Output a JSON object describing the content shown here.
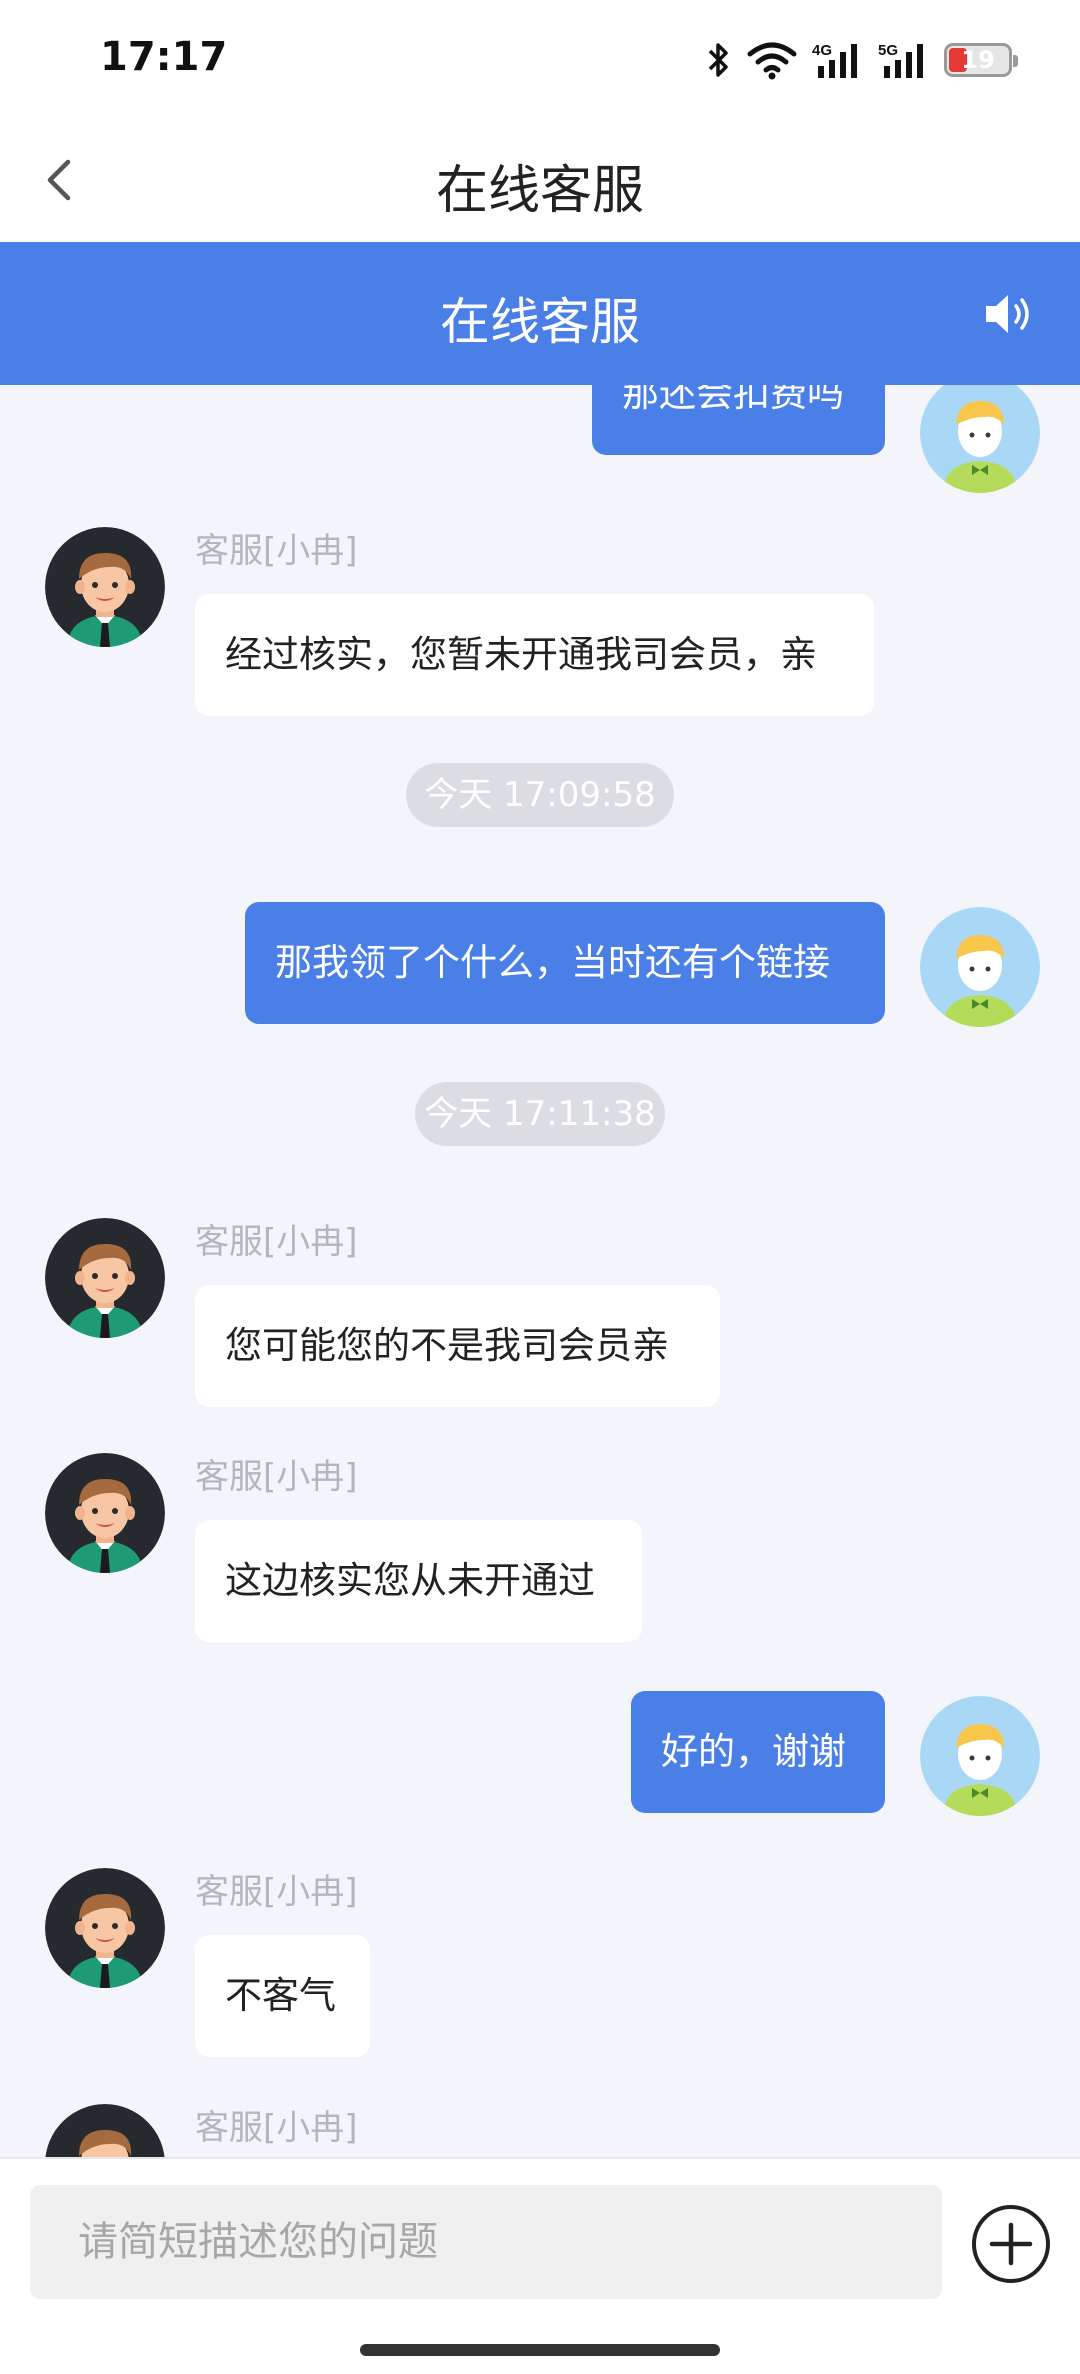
{
  "status_bar": {
    "time": "17:17",
    "network_1": "4G",
    "network_2": "5G",
    "battery_level": "19",
    "icons": [
      "bluetooth-icon",
      "wifi-icon",
      "signal-4g-icon",
      "signal-5g-icon",
      "battery-icon"
    ]
  },
  "nav": {
    "title": "在线客服",
    "back_icon": "chevron-left-icon"
  },
  "header": {
    "title": "在线客服",
    "speaker_icon": "speaker-icon",
    "color": "#4b7fe8"
  },
  "messages": [
    {
      "side": "right",
      "text": "那还会扣费吗"
    },
    {
      "side": "left",
      "sender": "客服[小冉]",
      "text": "经过核实，您暂未开通我司会员，亲"
    },
    {
      "type": "timestamp",
      "text": "今天 17:09:58"
    },
    {
      "side": "right",
      "text": "那我领了个什么，当时还有个链接"
    },
    {
      "type": "timestamp",
      "text": "今天 17:11:38"
    },
    {
      "side": "left",
      "sender": "客服[小冉]",
      "text": "您可能您的不是我司会员亲"
    },
    {
      "side": "left",
      "sender": "客服[小冉]",
      "text": "这边核实您从未开通过"
    },
    {
      "side": "right",
      "text": "好的，谢谢"
    },
    {
      "side": "left",
      "sender": "客服[小冉]",
      "text": "不客气"
    },
    {
      "side": "left",
      "sender": "客服[小冉]",
      "text": ""
    }
  ],
  "input": {
    "placeholder": "请简短描述您的问题",
    "value": "",
    "plus_icon": "plus-circle-icon"
  },
  "colors": {
    "accent": "#4b7fe8",
    "chat_background": "#f4f5fa",
    "sender_name": "#b4b6bd",
    "timestamp_pill": "#dcdde2"
  }
}
